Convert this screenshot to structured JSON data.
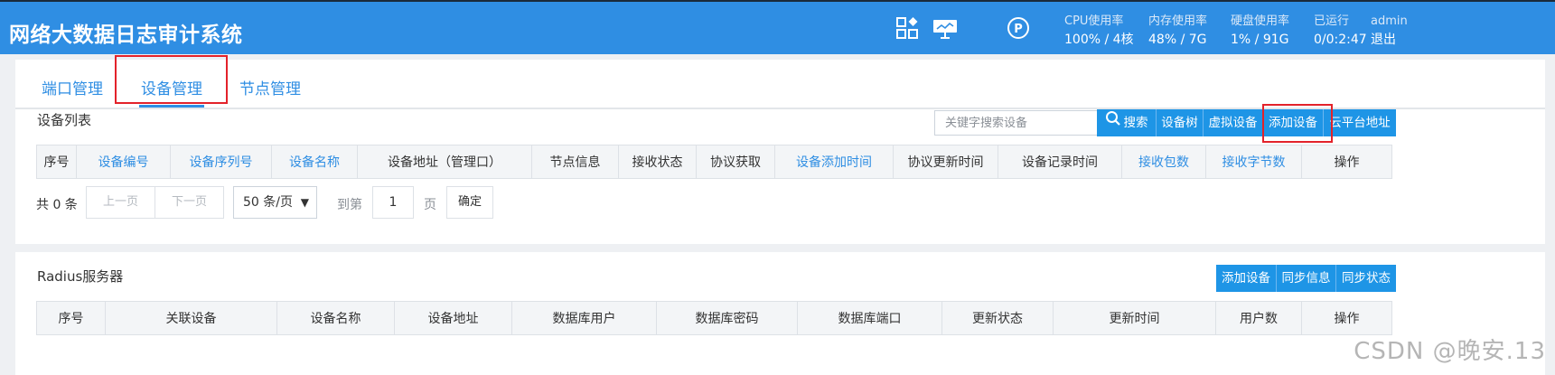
{
  "app": {
    "title": "网络大数据日志审计系统"
  },
  "stats": {
    "cpu": {
      "label": "CPU使用率",
      "value": "100% / 4核"
    },
    "memory": {
      "label": "内存使用率",
      "value": "48% / 7G"
    },
    "disk": {
      "label": "硬盘使用率",
      "value": "1% / 91G"
    },
    "uptime": {
      "label": "已运行",
      "value": "0/0:2:47"
    },
    "user": {
      "name": "admin",
      "logout": "退出"
    }
  },
  "tabs": [
    {
      "label": "端口管理"
    },
    {
      "label": "设备管理",
      "active": true
    },
    {
      "label": "节点管理"
    }
  ],
  "device_list": {
    "title": "设备列表",
    "search_placeholder": "关键字搜索设备",
    "buttons": {
      "search": "搜索",
      "device_tree": "设备树",
      "virtual_device": "虚拟设备",
      "add_device": "添加设备",
      "cloud_address": "云平台地址"
    },
    "columns": [
      "序号",
      "设备编号",
      "设备序列号",
      "设备名称",
      "设备地址（管理口）",
      "节点信息",
      "接收状态",
      "协议获取",
      "设备添加时间",
      "协议更新时间",
      "设备记录时间",
      "接收包数",
      "接收字节数",
      "操作"
    ],
    "pager": {
      "total": "共 0 条",
      "prev": "上一页",
      "next": "下一页",
      "page_size": "50 条/页",
      "goto_prefix": "到第",
      "goto_value": "1",
      "goto_suffix": "页",
      "confirm": "确定"
    }
  },
  "radius": {
    "title": "Radius服务器",
    "buttons": {
      "add_device": "添加设备",
      "sync_info": "同步信息",
      "sync_status": "同步状态"
    },
    "columns": [
      "序号",
      "关联设备",
      "设备名称",
      "设备地址",
      "数据库用户",
      "数据库密码",
      "数据库端口",
      "更新状态",
      "更新时间",
      "用户数",
      "操作"
    ]
  },
  "watermark": "CSDN @晚安.13",
  "colors": {
    "header": "#2f8ee3",
    "primary_button": "#1e95e6",
    "link": "#2f8ee3",
    "highlight": "#e3222a"
  }
}
